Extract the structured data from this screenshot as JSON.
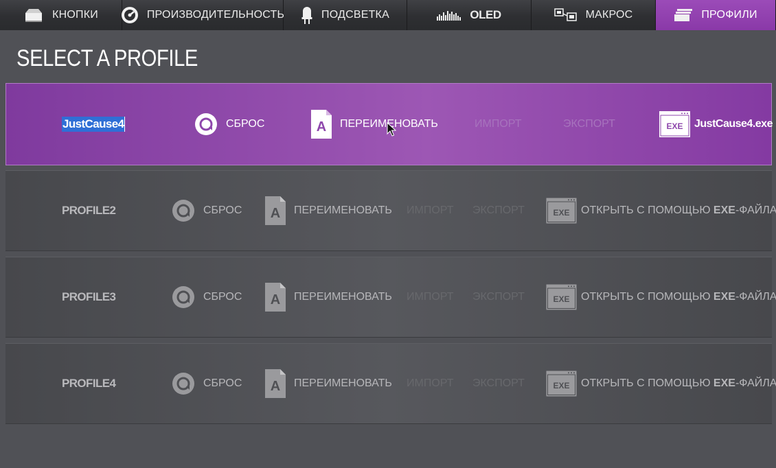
{
  "tabs": [
    {
      "label": "КНОПКИ",
      "icon": "keyboard-icon"
    },
    {
      "label": "ПРОИЗВОДИТЕЛЬНОСТЬ",
      "icon": "gauge-icon"
    },
    {
      "label": "ПОДСВЕТКА",
      "icon": "led-icon"
    },
    {
      "label": "OLED",
      "icon": "oled-bars-icon"
    },
    {
      "label": "МАКРОС",
      "icon": "macro-icon"
    },
    {
      "label": "ПРОФИЛИ",
      "icon": "profiles-icon",
      "active": true
    }
  ],
  "page_title": "SELECT A PROFILE",
  "profiles": [
    {
      "name": "JustCause4",
      "reset": "СБРОС",
      "rename": "ПЕРЕИМЕНОВАТЬ",
      "import": "ИМПОРТ",
      "export": "ЭКСПОРТ",
      "exe_badge": "EXE",
      "exe_label": "JustCause4.exe",
      "active": true
    },
    {
      "name": "PROFILE2",
      "reset": "СБРОС",
      "rename": "ПЕРЕИМЕНОВАТЬ",
      "import": "ИМПОРТ",
      "export": "ЭКСПОРТ",
      "exe_badge": "EXE",
      "exe_prefix": "ОТКРЫТЬ С ПОМОЩЬЮ ",
      "exe_bold": "EXE",
      "exe_suffix": "-ФАЙЛА"
    },
    {
      "name": "PROFILE3",
      "reset": "СБРОС",
      "rename": "ПЕРЕИМЕНОВАТЬ",
      "import": "ИМПОРТ",
      "export": "ЭКСПОРТ",
      "exe_badge": "EXE",
      "exe_prefix": "ОТКРЫТЬ С ПОМОЩЬЮ ",
      "exe_bold": "EXE",
      "exe_suffix": "-ФАЙЛА"
    },
    {
      "name": "PROFILE4",
      "reset": "СБРОС",
      "rename": "ПЕРЕИМЕНОВАТЬ",
      "import": "ИМПОРТ",
      "export": "ЭКСПОРТ",
      "exe_badge": "EXE",
      "exe_prefix": "ОТКРЫТЬ С ПОМОЩЬЮ ",
      "exe_bold": "EXE",
      "exe_suffix": "-ФАЙЛА"
    }
  ],
  "colors": {
    "accent": "#9b4bb8",
    "background": "#505156",
    "selection": "#2f6fd6"
  }
}
